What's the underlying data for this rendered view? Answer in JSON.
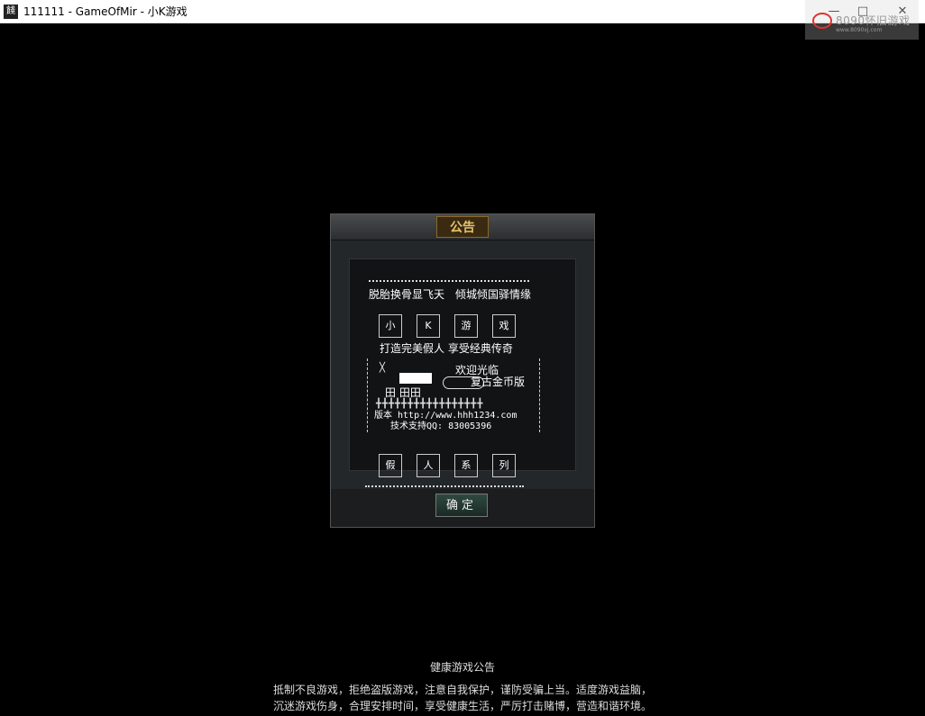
{
  "window": {
    "app_icon_glyph": "餞",
    "title": "111111 - GameOfMir - 小K游戏",
    "minimize": "—",
    "maximize": "□",
    "close": "✕"
  },
  "watermark": {
    "text": "8090怀旧游戏",
    "subtext": "www.8090xj.com"
  },
  "dialog": {
    "title": "公告",
    "line1": "脱胎换骨显飞天　倾城倾国驿情缘",
    "tiles_top": [
      "小",
      "K",
      "游",
      "戏"
    ],
    "line2": "打造完美假人 享受经典传奇",
    "art_left": "╳",
    "welcome": "欢迎光临",
    "art_tian": "田 田田",
    "edition": "复古金币版",
    "plus_row": "╋╋╋╋╋╋╋╋╋╋╋╋╋╋╋╋╋",
    "version_line": "版本 http://www.hhh1234.com",
    "support_line": "技术支持QQ: 83005396",
    "tiles_bottom": [
      "假",
      "人",
      "系",
      "列"
    ],
    "ok_label": "确定"
  },
  "notice": {
    "title": "健康游戏公告",
    "line1": "抵制不良游戏，拒绝盗版游戏，注意自我保护，谨防受骗上当。适度游戏益脑，",
    "line2": "沉迷游戏伤身，合理安排时间，享受健康生活，严厉打击赌博，营造和谐环境。"
  }
}
